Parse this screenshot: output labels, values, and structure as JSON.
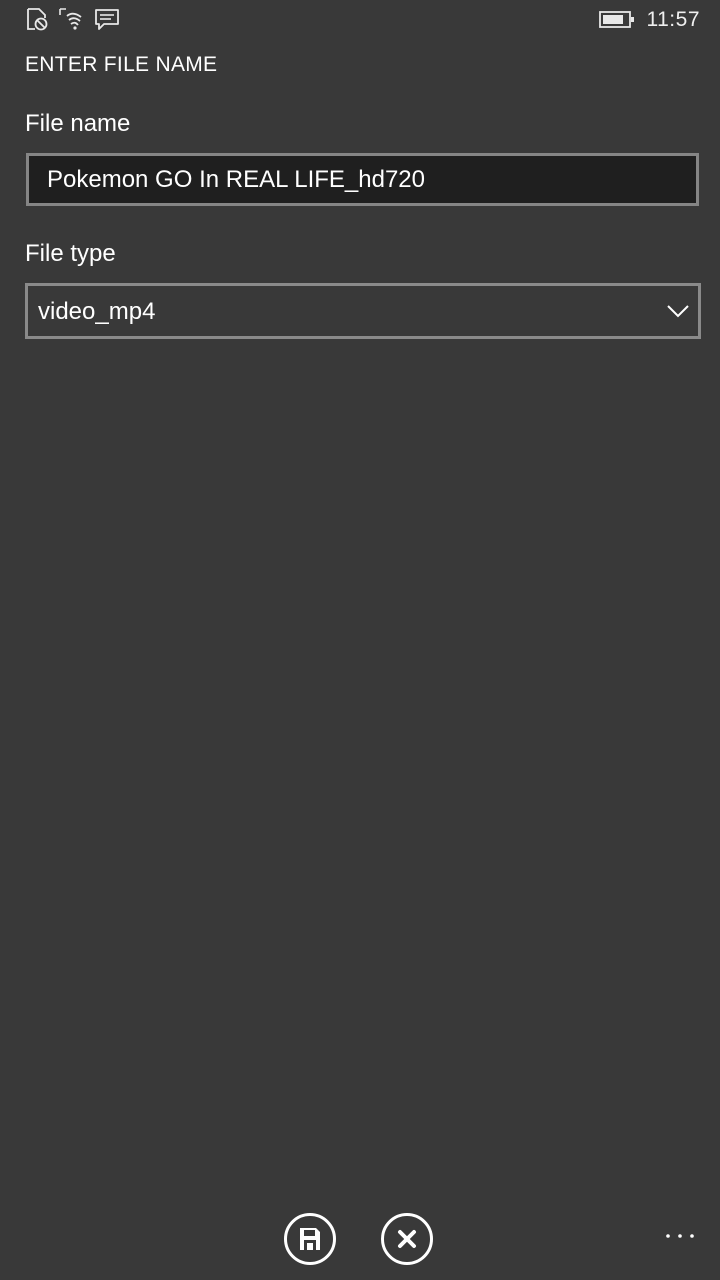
{
  "status_bar": {
    "icons": [
      "quiet-hours-icon",
      "wifi-icon",
      "notification-icon",
      "battery-icon"
    ],
    "time": "11:57"
  },
  "dialog": {
    "title": "ENTER FILE NAME",
    "file_name_label": "File name",
    "file_name_value": "Pokemon GO In REAL LIFE_hd720",
    "file_type_label": "File type",
    "file_type_selected": "video_mp4"
  },
  "app_bar": {
    "buttons": [
      "save-icon",
      "cancel-icon"
    ],
    "more": "more-icon"
  },
  "colors": {
    "background": "#393939",
    "input_background": "#1f1f1f",
    "border": "#858585",
    "text": "#ffffff"
  }
}
